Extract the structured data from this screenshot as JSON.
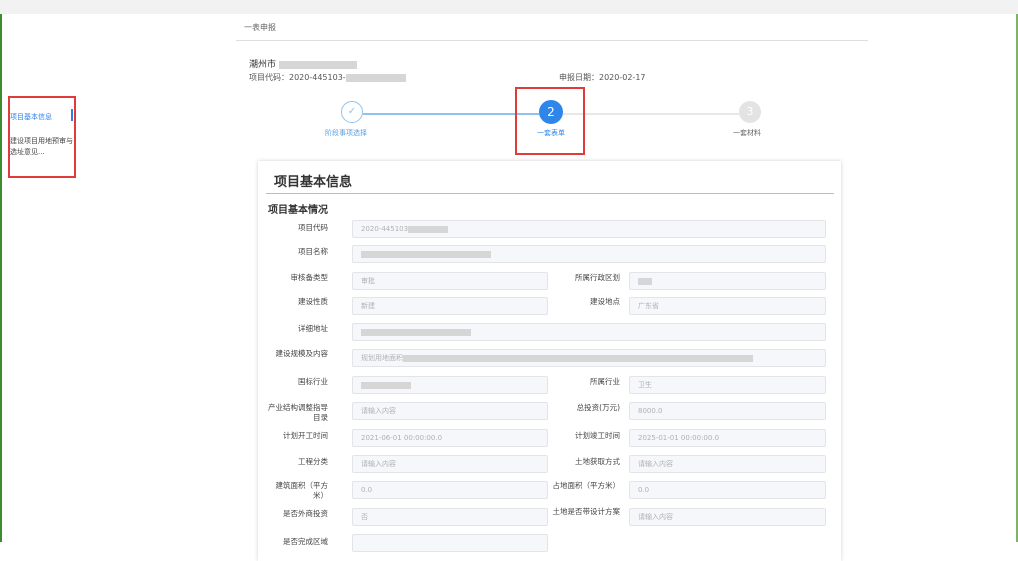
{
  "breadcrumb": "一表申报",
  "project": {
    "title": "潮州市",
    "code_label": "项目代码：",
    "code_value": "2020-445103-",
    "date_label": "申报日期：",
    "date_value": "2020-02-17"
  },
  "sidebar": {
    "items": [
      {
        "label": "项目基本信息",
        "active": true
      },
      {
        "label": "建设项目用地预审与选址意见..."
      }
    ]
  },
  "steps": [
    {
      "number": "✓",
      "label": "阶段事项选择",
      "state": "done"
    },
    {
      "number": "2",
      "label": "一套表单",
      "state": "active"
    },
    {
      "number": "3",
      "label": "一套材料",
      "state": "pending"
    }
  ],
  "card": {
    "title": "项目基本信息",
    "section": "项目基本情况"
  },
  "fields": {
    "code": {
      "label": "项目代码",
      "value": "2020-445103"
    },
    "name": {
      "label": "项目名称",
      "value": ""
    },
    "review_type": {
      "label": "审核备类型",
      "value": "审批"
    },
    "region": {
      "label": "所属行政区划",
      "value": ""
    },
    "nature": {
      "label": "建设性质",
      "value": "新建"
    },
    "location": {
      "label": "建设地点",
      "value": "广东省"
    },
    "address": {
      "label": "详细地址",
      "value": ""
    },
    "scale": {
      "label": "建设规模及内容",
      "value": "规划用地面积"
    },
    "industry": {
      "label": "国标行业",
      "value": ""
    },
    "belong_industry": {
      "label": "所属行业",
      "value": "卫生"
    },
    "catalog": {
      "label": "产业结构调整指导目录",
      "value": "请输入内容"
    },
    "invest": {
      "label": "总投资(万元)",
      "value": "8000.0"
    },
    "start_time": {
      "label": "计划开工时间",
      "value": "2021-06-01 00:00:00.0"
    },
    "end_time": {
      "label": "计划竣工时间",
      "value": "2025-01-01 00:00:00.0"
    },
    "category": {
      "label": "工程分类",
      "value": "请输入内容"
    },
    "land_method": {
      "label": "土地获取方式",
      "value": "请输入内容"
    },
    "build_area": {
      "label": "建筑面积（平方米）",
      "value": "0.0"
    },
    "land_area": {
      "label": "占地面积（平方米）",
      "value": "0.0"
    },
    "foreign": {
      "label": "是否外商投资",
      "value": "否"
    },
    "design_plan": {
      "label": "土地是否带设计方案",
      "value": "请输入内容"
    },
    "region_done": {
      "label": "是否完成区域",
      "value": ""
    }
  },
  "colors": {
    "accent": "#2f86ea",
    "highlight": "#e03b3b"
  }
}
